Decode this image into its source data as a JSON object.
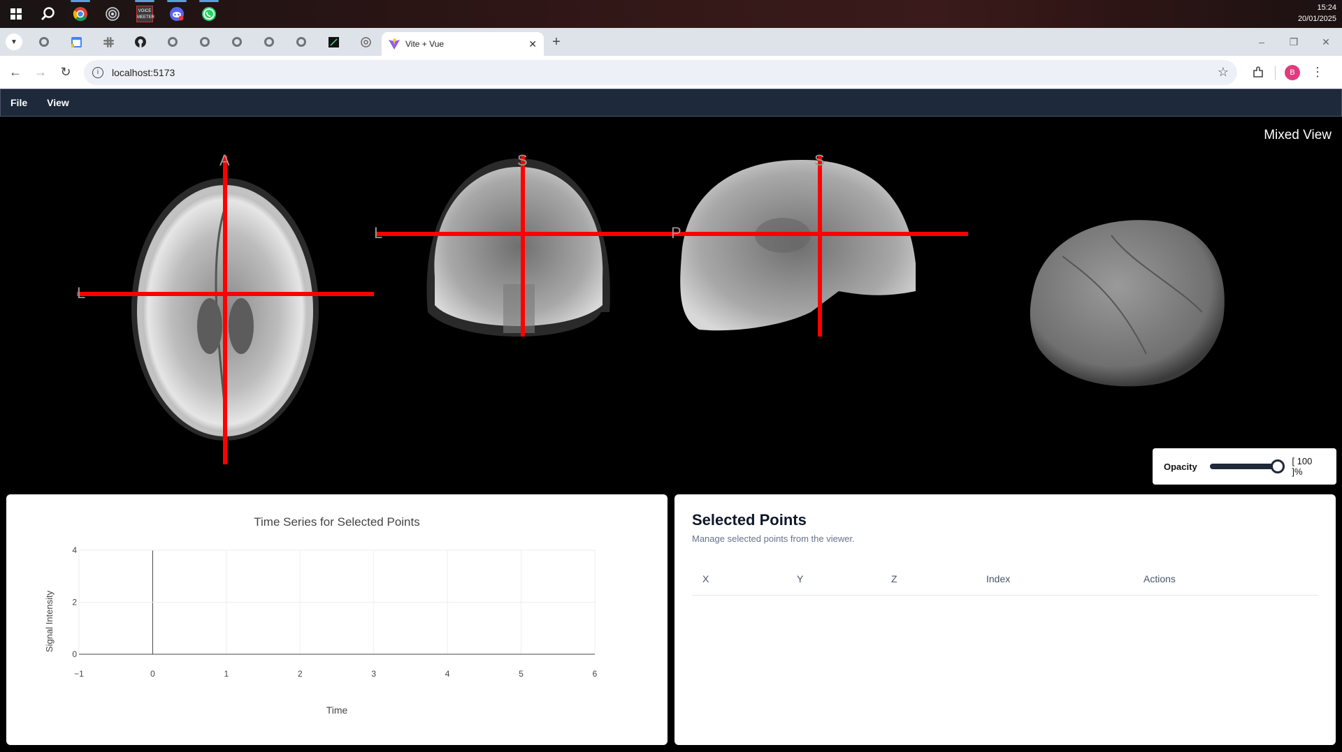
{
  "taskbar": {
    "icons": [
      "windows-start-icon",
      "search-icon",
      "chrome-icon",
      "obs-icon",
      "voicemeeter-icon",
      "discord-icon",
      "whatsapp-icon"
    ],
    "voicemeeter_text": "VOICE MEETER",
    "time": "15:24",
    "date": "20/01/2025"
  },
  "browser": {
    "active_tab_title": "Vite + Vue",
    "url": "localhost:5173",
    "profile_initial": "B"
  },
  "app": {
    "menu": [
      "File",
      "View"
    ],
    "view_label": "Mixed View",
    "orientation_labels": {
      "axial_top": "A",
      "axial_left": "L",
      "coronal_top": "S",
      "coronal_left": "L",
      "sagittal_top": "S",
      "sagittal_left": "P"
    },
    "opacity": {
      "label": "Opacity",
      "value": 100,
      "display": "[ 100 ]%"
    },
    "crosshair_color": "#ff0000"
  },
  "chart_data": {
    "type": "line",
    "title": "Time Series for Selected Points",
    "xlabel": "Time",
    "ylabel": "Signal Intensity",
    "xlim": [
      -1,
      6
    ],
    "ylim": [
      0,
      4
    ],
    "xticks": [
      "−1",
      "0",
      "1",
      "2",
      "3",
      "4",
      "5",
      "6"
    ],
    "yticks": [
      "0",
      "2",
      "4"
    ],
    "series": []
  },
  "points": {
    "title": "Selected Points",
    "subtitle": "Manage selected points from the viewer.",
    "columns": [
      "X",
      "Y",
      "Z",
      "Index",
      "Actions"
    ],
    "rows": []
  }
}
